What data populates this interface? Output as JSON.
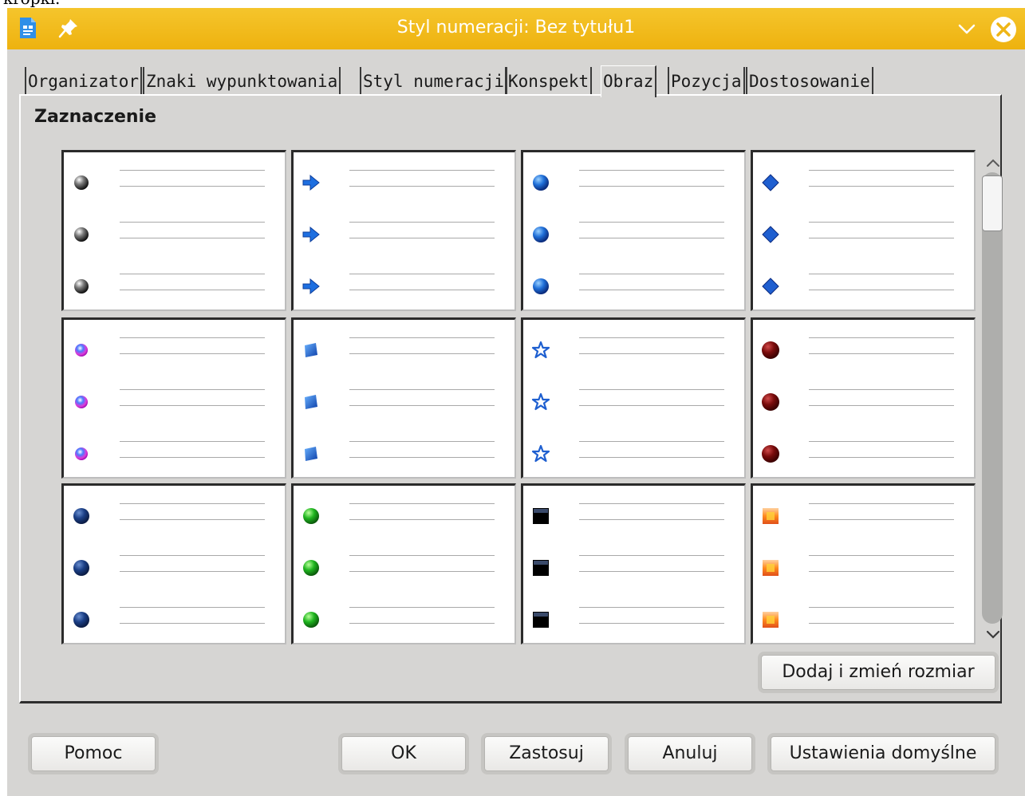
{
  "background_text": "kropki.",
  "window": {
    "title": "Styl numeracji: Bez tytułu1"
  },
  "tabs": [
    {
      "label": "Organizator"
    },
    {
      "label": "Znaki wypunktowania"
    },
    {
      "label": "Styl numeracji"
    },
    {
      "label": "Konspekt"
    },
    {
      "label": "Obraz",
      "active": true
    },
    {
      "label": "Pozycja"
    },
    {
      "label": "Dostosowanie"
    }
  ],
  "section": {
    "label": "Zaznaczenie"
  },
  "bullet_images": [
    {
      "name": "gray-ball"
    },
    {
      "name": "blue-arrow"
    },
    {
      "name": "blue-sphere"
    },
    {
      "name": "blue-diamond"
    },
    {
      "name": "rainbow-ball"
    },
    {
      "name": "blue-square"
    },
    {
      "name": "blue-star"
    },
    {
      "name": "dark-red-ball"
    },
    {
      "name": "navy-ball"
    },
    {
      "name": "green-ball"
    },
    {
      "name": "black-square"
    },
    {
      "name": "orange-square"
    }
  ],
  "buttons": {
    "add_resize": "Dodaj i zmień rozmiar",
    "help": "Pomoc",
    "ok": "OK",
    "apply": "Zastosuj",
    "cancel": "Anuluj",
    "defaults": "Ustawienia domyślne"
  },
  "colors": {
    "titlebar": "#efb616",
    "dialog_bg": "#d6d5d3"
  }
}
